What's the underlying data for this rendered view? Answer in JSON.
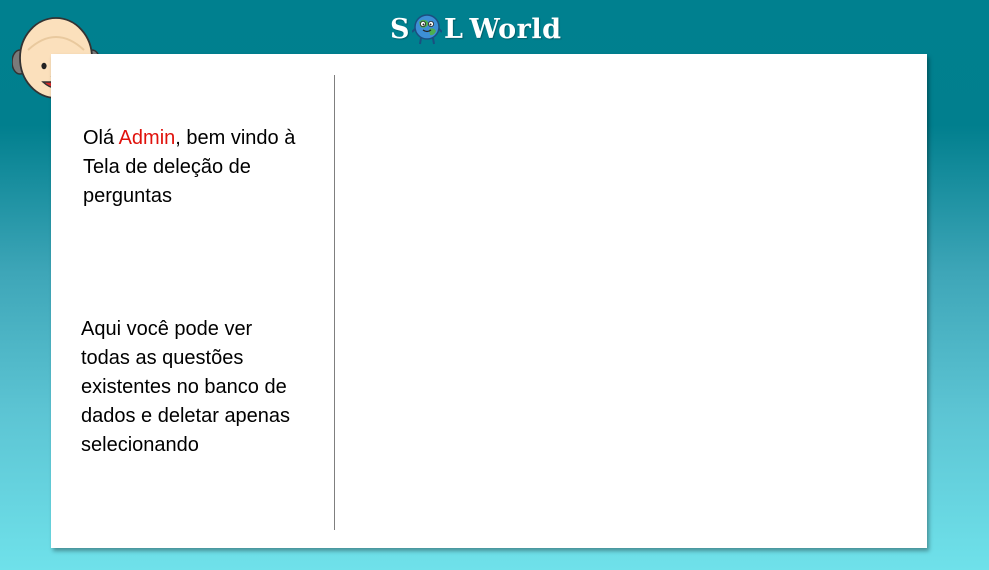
{
  "header": {
    "logo_prefix": "S",
    "logo_suffix": "L",
    "logo_word": "World",
    "logo_icon": "globe-mascot-icon"
  },
  "avatar": {
    "icon": "old-man-face-icon"
  },
  "sidebar": {
    "greeting_prefix": "Olá ",
    "user_name": "Admin",
    "greeting_suffix": ", bem vindo à Tela de deleção de perguntas",
    "info_text": "Aqui você pode ver todas as questões existentes no banco de dados e deletar apenas selecionando"
  },
  "colors": {
    "username": "#e0120c",
    "background_top": "#00808f",
    "background_bottom": "#6fe1ea"
  }
}
